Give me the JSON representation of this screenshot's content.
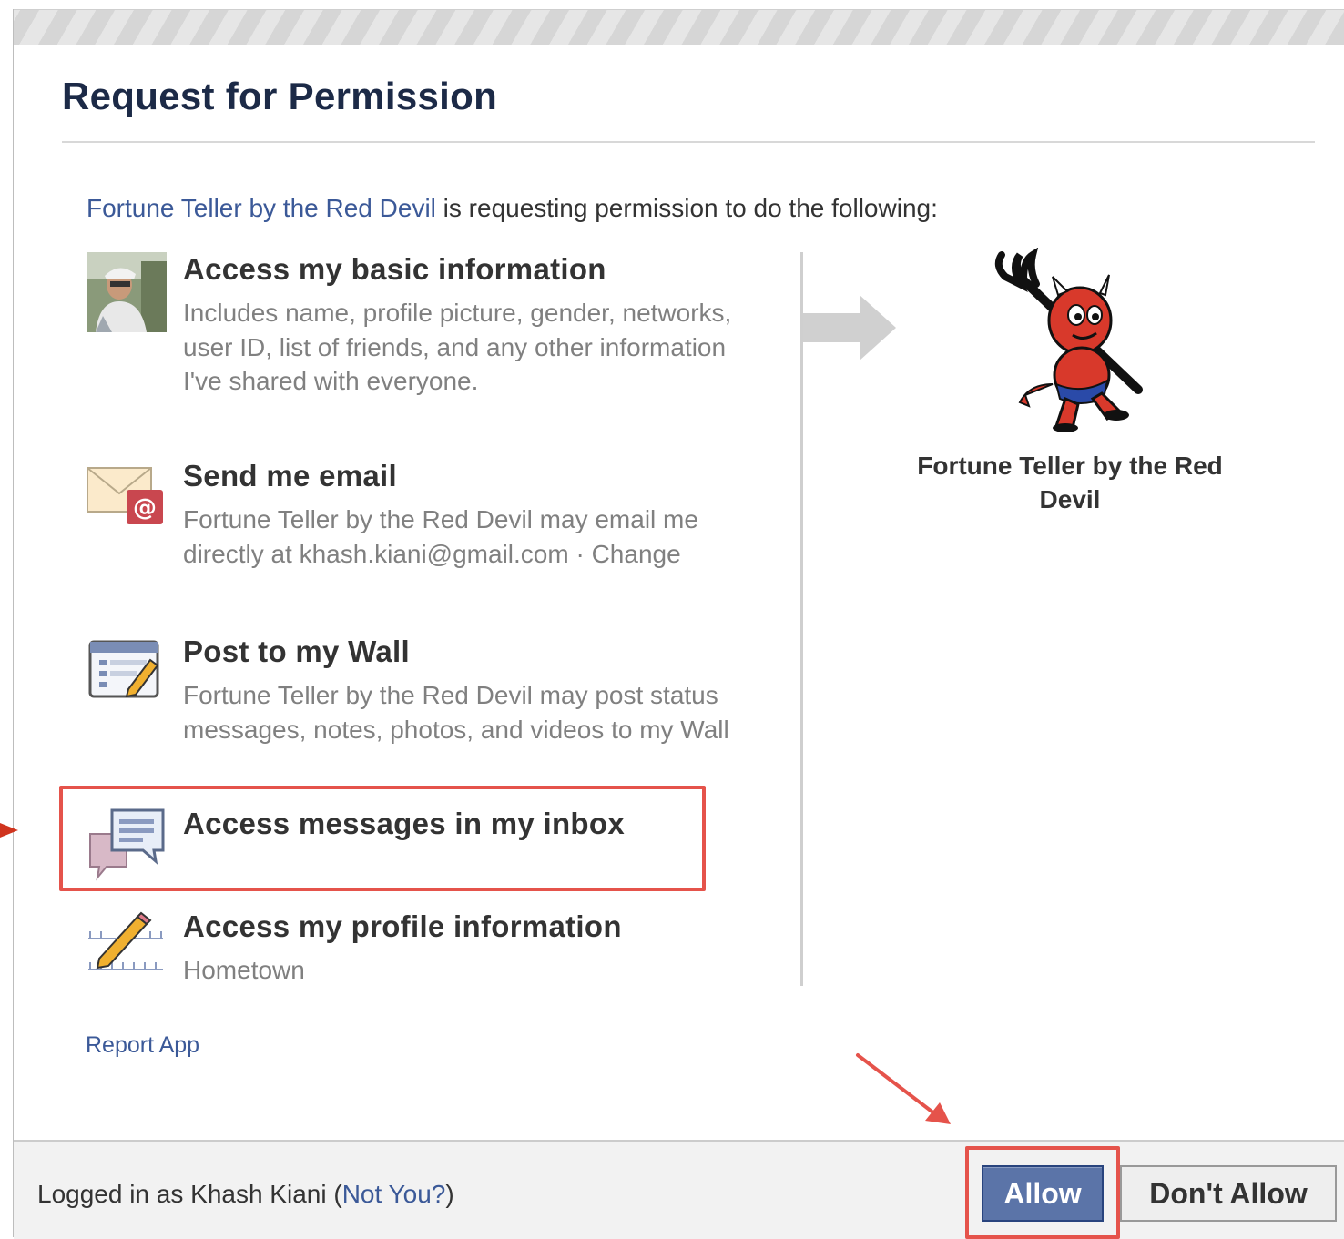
{
  "dialog": {
    "title": "Request for Permission"
  },
  "intro": {
    "app_link": "Fortune Teller by the Red Devil",
    "text": " is requesting permission to do the following:"
  },
  "permissions": [
    {
      "title": "Access my basic information",
      "description": "Includes name, profile picture, gender, networks, user ID, list of friends, and any other information I've shared with everyone.",
      "icon": "profile-photo-icon"
    },
    {
      "title": "Send me email",
      "description_prefix": "Fortune Teller by the Red Devil may email me directly at khash.kiani@gmail.com · ",
      "change_link": "Change",
      "icon": "email-icon"
    },
    {
      "title": "Post to my Wall",
      "description": "Fortune Teller by the Red Devil may post status messages, notes, photos, and videos to my Wall",
      "icon": "wall-post-icon"
    },
    {
      "title": "Access messages in my inbox",
      "icon": "messages-icon"
    },
    {
      "title": "Access my profile information",
      "description": "Hometown",
      "icon": "profile-edit-icon"
    }
  ],
  "app": {
    "name": "Fortune Teller by the Red Devil",
    "logo_icon": "red-devil-logo"
  },
  "report_link": "Report App",
  "footer": {
    "logged_in_prefix": "Logged in as Khash Kiani (",
    "not_you_link": "Not You?",
    "logged_in_suffix": ")",
    "allow_label": "Allow",
    "deny_label": "Don't Allow"
  },
  "colors": {
    "link": "#3b5998",
    "title": "#1c2a47",
    "annotation": "#e5534b",
    "allow_button": "#5b74a8"
  }
}
